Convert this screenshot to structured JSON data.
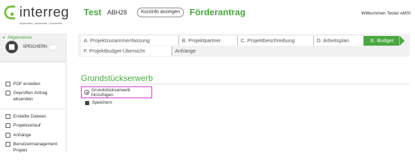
{
  "header": {
    "logo_word": "interreg",
    "logo_sub": "Alpenrhein | Bodensee | Hochrhein",
    "project_title": "Test",
    "project_code": "ABH28",
    "kurzinfo_label": "Kurzinfo anzeigen",
    "form_title": "Förderantrag",
    "welcome": "Willkommen Tester eMS!"
  },
  "sidebar": {
    "save_label": "SPEICHERN",
    "section": "Allgemeines",
    "items": [
      {
        "label": "PDF erstellen"
      },
      {
        "label": "Geprüften Antrag absenden"
      },
      {
        "label": "Erstellte Dateien"
      },
      {
        "label": "Projektverlauf"
      },
      {
        "label": "Anhänge"
      },
      {
        "label": "Benutzermanagement Projekt"
      }
    ]
  },
  "tabs": [
    {
      "label": "A. Projektzusammenfassung",
      "active": false
    },
    {
      "label": "B. Projektpartner",
      "active": false
    },
    {
      "label": "C. Projektbeschreibung",
      "active": false
    },
    {
      "label": "D. Arbeitsplan",
      "active": false
    },
    {
      "label": "E. Budget",
      "active": true
    },
    {
      "label": "F. Projektbudget-Übersicht",
      "active": false
    },
    {
      "label": "Anhänge",
      "active": false
    }
  ],
  "main": {
    "heading": "Grundstückserwerb",
    "add_label": "Grundstückserwerb hinzufügen",
    "save_label": "Speichern"
  },
  "colors": {
    "accent": "#4aa840",
    "highlight": "#cc33cc"
  }
}
